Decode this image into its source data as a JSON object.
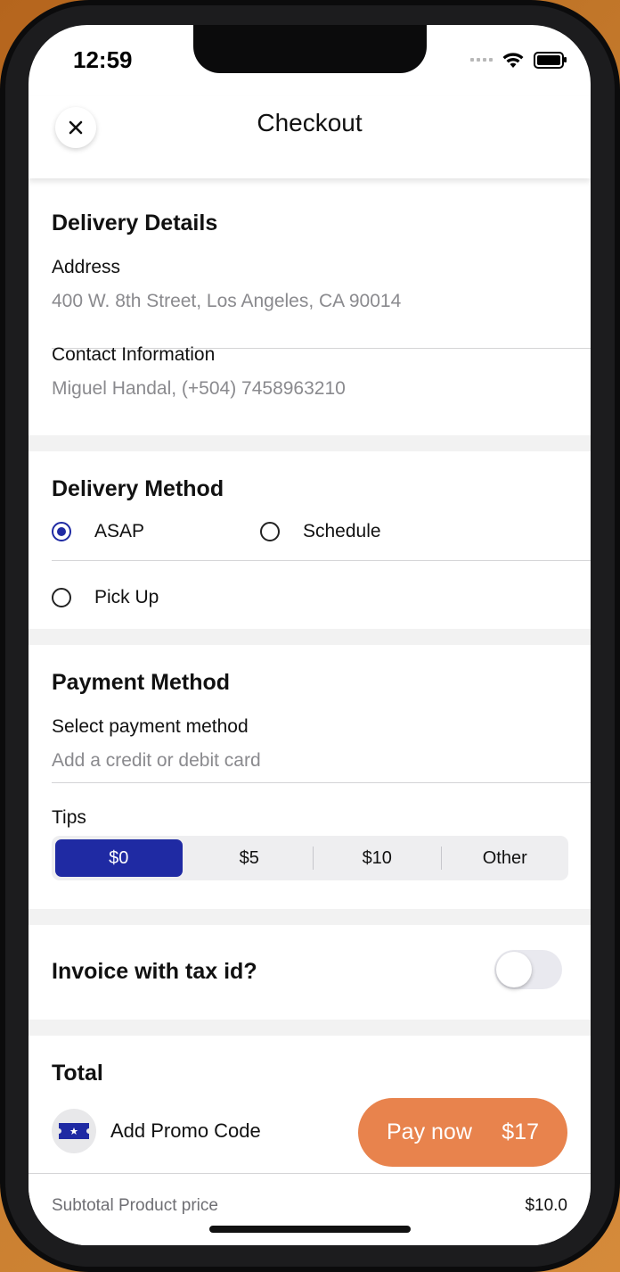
{
  "status": {
    "time": "12:59"
  },
  "nav": {
    "title": "Checkout"
  },
  "delivery_details": {
    "title": "Delivery Details",
    "address_label": "Address",
    "address_value": "400 W. 8th Street, Los Angeles, CA 90014",
    "contact_label": "Contact Information",
    "contact_value": "Miguel Handal, (+504) 7458963210"
  },
  "delivery_method": {
    "title": "Delivery Method",
    "options": [
      {
        "label": "ASAP",
        "selected": true
      },
      {
        "label": "Schedule",
        "selected": false
      },
      {
        "label": "Pick Up",
        "selected": false
      }
    ]
  },
  "payment_method": {
    "title": "Payment Method",
    "select_label": "Select payment method",
    "select_value": "Add a credit or debit card",
    "tips_label": "Tips",
    "tips": [
      "$0",
      "$5",
      "$10",
      "Other"
    ],
    "tips_selected": "$0"
  },
  "invoice": {
    "label": "Invoice with tax id?",
    "enabled": false
  },
  "total": {
    "title": "Total",
    "promo_label": "Add Promo Code",
    "subtotal_label": "Subtotal Product price",
    "subtotal_value": "$10.0"
  },
  "pay": {
    "label": "Pay now",
    "amount": "$17"
  },
  "colors": {
    "accent": "#1f2aa3",
    "pay_button": "#e8834d"
  }
}
